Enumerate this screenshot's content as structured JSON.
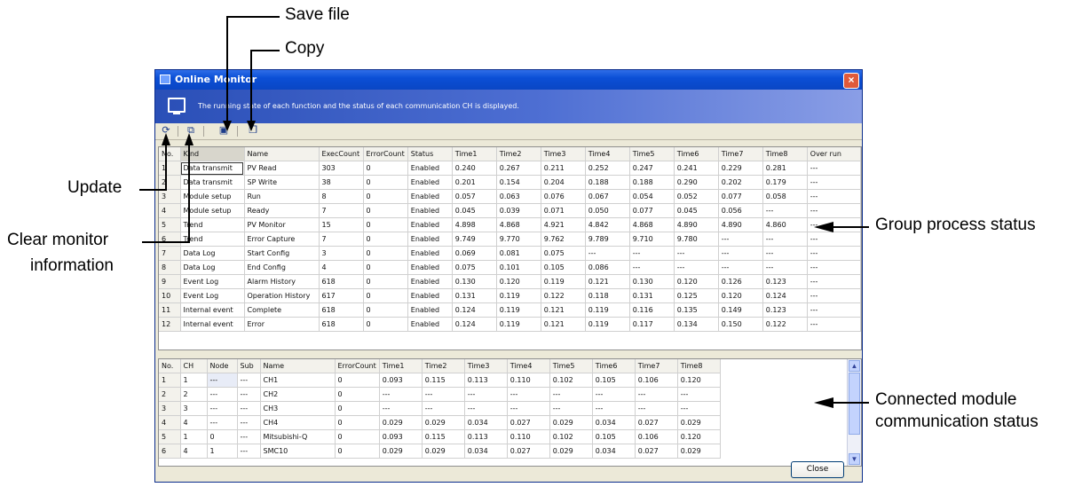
{
  "window": {
    "title": "Online Monitor",
    "banner_text": "The running state of each function and the status of each communication CH is displayed.",
    "close_label": "Close"
  },
  "toolbar": {
    "icons": [
      "update-icon",
      "clear-icon",
      "save-icon",
      "copy-icon"
    ]
  },
  "callouts": {
    "save_file": "Save file",
    "copy": "Copy",
    "update": "Update",
    "clear_line1": "Clear monitor",
    "clear_line2": "information",
    "group_process": "Group process status",
    "connected_line1": "Connected module",
    "connected_line2": "communication status"
  },
  "group_table": {
    "columns": [
      "No.",
      "Kind",
      "Name",
      "ExecCount",
      "ErrorCount",
      "Status",
      "Time1",
      "Time2",
      "Time3",
      "Time4",
      "Time5",
      "Time6",
      "Time7",
      "Time8",
      "Over run"
    ],
    "rows": [
      [
        "1",
        "Data transmit",
        "PV Read",
        "303",
        "0",
        "Enabled",
        "0.240",
        "0.267",
        "0.211",
        "0.252",
        "0.247",
        "0.241",
        "0.229",
        "0.281",
        "---"
      ],
      [
        "2",
        "Data transmit",
        "SP Write",
        "38",
        "0",
        "Enabled",
        "0.201",
        "0.154",
        "0.204",
        "0.188",
        "0.188",
        "0.290",
        "0.202",
        "0.179",
        "---"
      ],
      [
        "3",
        "Module setup",
        "Run",
        "8",
        "0",
        "Enabled",
        "0.057",
        "0.063",
        "0.076",
        "0.067",
        "0.054",
        "0.052",
        "0.077",
        "0.058",
        "---"
      ],
      [
        "4",
        "Module setup",
        "Ready",
        "7",
        "0",
        "Enabled",
        "0.045",
        "0.039",
        "0.071",
        "0.050",
        "0.077",
        "0.045",
        "0.056",
        "---",
        "---"
      ],
      [
        "5",
        "Trend",
        "PV Monitor",
        "15",
        "0",
        "Enabled",
        "4.898",
        "4.868",
        "4.921",
        "4.842",
        "4.868",
        "4.890",
        "4.890",
        "4.860",
        "---"
      ],
      [
        "6",
        "Trend",
        "Error Capture",
        "7",
        "0",
        "Enabled",
        "9.749",
        "9.770",
        "9.762",
        "9.789",
        "9.710",
        "9.780",
        "---",
        "---",
        "---"
      ],
      [
        "7",
        "Data Log",
        "Start Config",
        "3",
        "0",
        "Enabled",
        "0.069",
        "0.081",
        "0.075",
        "---",
        "---",
        "---",
        "---",
        "---",
        "---"
      ],
      [
        "8",
        "Data Log",
        "End Config",
        "4",
        "0",
        "Enabled",
        "0.075",
        "0.101",
        "0.105",
        "0.086",
        "---",
        "---",
        "---",
        "---",
        "---"
      ],
      [
        "9",
        "Event Log",
        "Alarm History",
        "618",
        "0",
        "Enabled",
        "0.130",
        "0.120",
        "0.119",
        "0.121",
        "0.130",
        "0.120",
        "0.126",
        "0.123",
        "---"
      ],
      [
        "10",
        "Event Log",
        "Operation History",
        "617",
        "0",
        "Enabled",
        "0.131",
        "0.119",
        "0.122",
        "0.118",
        "0.131",
        "0.125",
        "0.120",
        "0.124",
        "---"
      ],
      [
        "11",
        "Internal event",
        "Complete",
        "618",
        "0",
        "Enabled",
        "0.124",
        "0.119",
        "0.121",
        "0.119",
        "0.116",
        "0.135",
        "0.149",
        "0.123",
        "---"
      ],
      [
        "12",
        "Internal event",
        "Error",
        "618",
        "0",
        "Enabled",
        "0.124",
        "0.119",
        "0.121",
        "0.119",
        "0.117",
        "0.134",
        "0.150",
        "0.122",
        "---"
      ]
    ]
  },
  "comm_table": {
    "columns": [
      "No.",
      "CH",
      "Node",
      "Sub",
      "Name",
      "ErrorCount",
      "Time1",
      "Time2",
      "Time3",
      "Time4",
      "Time5",
      "Time6",
      "Time7",
      "Time8"
    ],
    "rows": [
      [
        "1",
        "1",
        "---",
        "---",
        "CH1",
        "0",
        "0.093",
        "0.115",
        "0.113",
        "0.110",
        "0.102",
        "0.105",
        "0.106",
        "0.120"
      ],
      [
        "2",
        "2",
        "---",
        "---",
        "CH2",
        "0",
        "---",
        "---",
        "---",
        "---",
        "---",
        "---",
        "---",
        "---"
      ],
      [
        "3",
        "3",
        "---",
        "---",
        "CH3",
        "0",
        "---",
        "---",
        "---",
        "---",
        "---",
        "---",
        "---",
        "---"
      ],
      [
        "4",
        "4",
        "---",
        "---",
        "CH4",
        "0",
        "0.029",
        "0.029",
        "0.034",
        "0.027",
        "0.029",
        "0.034",
        "0.027",
        "0.029"
      ],
      [
        "5",
        "1",
        "0",
        "---",
        "Mitsubishi-Q",
        "0",
        "0.093",
        "0.115",
        "0.113",
        "0.110",
        "0.102",
        "0.105",
        "0.106",
        "0.120"
      ],
      [
        "6",
        "4",
        "1",
        "---",
        "SMC10",
        "0",
        "0.029",
        "0.029",
        "0.034",
        "0.027",
        "0.029",
        "0.034",
        "0.027",
        "0.029"
      ]
    ]
  }
}
